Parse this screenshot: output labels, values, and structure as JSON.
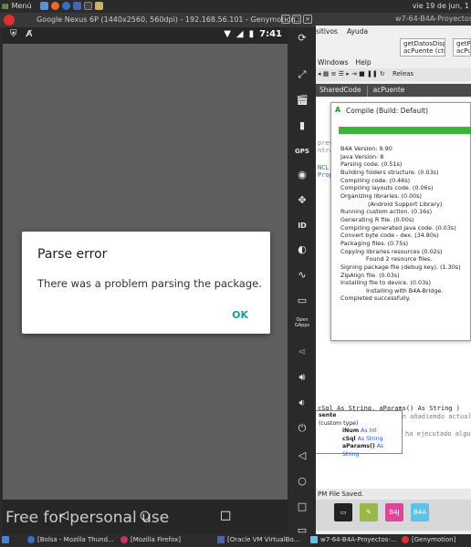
{
  "top_panel": {
    "menu_label": "Menú",
    "clock": "vie 19 de jun, 1"
  },
  "ide": {
    "title": "w7-64-B4A-Proyectos-...",
    "menu1": [
      "sitivos",
      "Ayuda"
    ],
    "btn1": {
      "line1": "getDatosDispo",
      "line2": "acPuente (ctrl + 1)"
    },
    "btn2": {
      "line1": "getPl",
      "line2": "acPue"
    },
    "menu2": [
      "Windows",
      "Help"
    ],
    "toolbar_text": "Releas",
    "tabs": [
      "SharedCode",
      "acPuente"
    ],
    "code_fragments": [
      "prev",
      "ntra",
      "NCL",
      "Prop"
    ],
    "code_line": "cSql As String, aParams() As String )",
    "code_comment": "aumentar según se vayan añadiendo actual",
    "code_comment2": "ha ejecutado algu",
    "status_text": "PM   File Saved.",
    "taskicons": [
      "B4J",
      "B4A"
    ]
  },
  "compile": {
    "title": "Compile (Build: Default)",
    "log": [
      "B4A Version: 9.90",
      "Java Version: 8",
      "Parsing code.    (0.51s)",
      "Building folders structure.    (0.03s)",
      "Compiling code.    (0.46s)",
      "Compiling layouts code.    (0.06s)",
      "Organizing libraries.    (0.00s)",
      "    (Android Support Library)",
      "Running custom action.    (0.16s)",
      "Generating R file.    (0.00s)",
      "Compiling generated Java code.    (0.03s)",
      "Convert byte code - dex.    (34.80s)",
      "Packaging files.    (0.75s)",
      "Copying libraries resources    (0.02s)",
      "    Found 2 resource files.",
      "Signing package file (debug key).    (1.30s)",
      "ZipAlign file.    (0.03s)",
      "Installing file to device.    (0.03s)",
      "    Installing with B4A-Bridge.",
      "Completed successfully."
    ]
  },
  "autocomplete": {
    "header": "sente",
    "subheader": "(custom type)",
    "items": [
      {
        "name": "iNum",
        "type": "As Int"
      },
      {
        "name": "cSql",
        "type": "As String"
      },
      {
        "name": "aParams()",
        "type": "As String"
      }
    ]
  },
  "emulator": {
    "title": "Google Nexus 6P (1440x2560, 560dpi) - 192.168.56.101 - Genymotion",
    "time": "7:41",
    "watermark": "Free for personal use",
    "dialog": {
      "title": "Parse error",
      "message": "There was a problem parsing the package.",
      "ok_label": "OK"
    },
    "sidebar": {
      "open_gapps": "Open GApps"
    }
  },
  "taskbar": {
    "items": [
      "[Bolsa - Mozilla Thund...",
      "[Mozilla Firefox]",
      "[Oracle VM VirtualBo...",
      "w7-64-B4A-Proyectos-...",
      "[Genymotion]"
    ]
  }
}
